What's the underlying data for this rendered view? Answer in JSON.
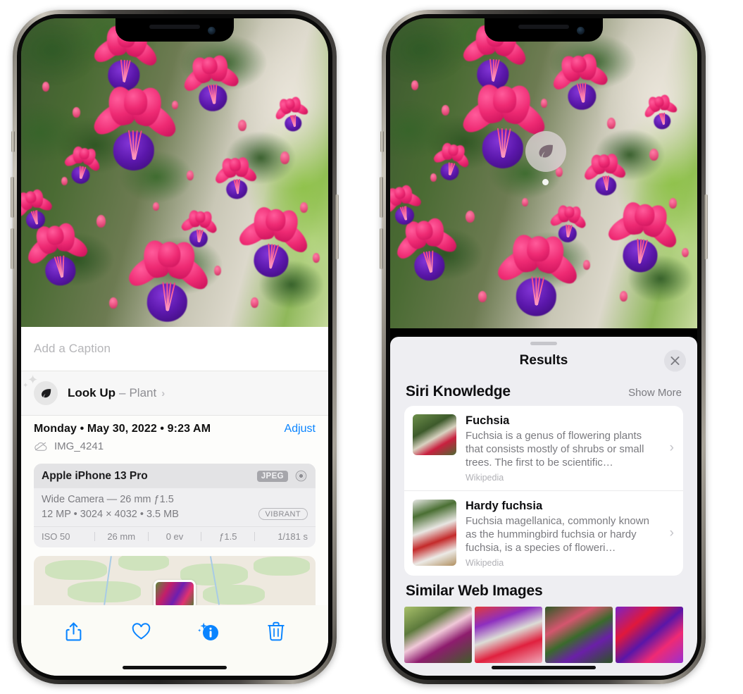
{
  "left_phone": {
    "caption": {
      "placeholder": "Add a Caption",
      "value": ""
    },
    "look_up": {
      "icon": "leaf-icon",
      "label": "Look Up",
      "separator": " – ",
      "subject": "Plant",
      "chevron": "›"
    },
    "meta": {
      "date": "Monday • May 30, 2022 • 9:23 AM",
      "adjust_label": "Adjust",
      "cloud_icon": "icloud-slash-icon",
      "filename": "IMG_4241"
    },
    "camera_card": {
      "device": "Apple iPhone 13 Pro",
      "format_badge": "JPEG",
      "hdr_icon": "aperture-icon",
      "lens_line": "Wide Camera — 26 mm ƒ1.5",
      "size_line": "12 MP • 3024 × 4032 • 3.5 MB",
      "style_badge": "VIBRANT",
      "exif": [
        "ISO 50",
        "26 mm",
        "0 ev",
        "ƒ1.5",
        "1/181 s"
      ]
    },
    "toolbar": [
      {
        "name": "share-icon",
        "label": "Share"
      },
      {
        "name": "heart-icon",
        "label": "Favorite"
      },
      {
        "name": "info-sparkle-icon",
        "label": "Info"
      },
      {
        "name": "trash-icon",
        "label": "Delete"
      }
    ]
  },
  "right_phone": {
    "visual_look_up_badge": {
      "icon": "leaf-icon"
    },
    "sheet": {
      "title": "Results",
      "close_icon": "close-icon"
    },
    "siri_knowledge": {
      "heading": "Siri Knowledge",
      "show_more": "Show More",
      "entries": [
        {
          "title": "Fuchsia",
          "description": "Fuchsia is a genus of flowering plants that consists mostly of shrubs or small trees. The first to be scientific…",
          "source": "Wikipedia",
          "chevron": "›"
        },
        {
          "title": "Hardy fuchsia",
          "description": "Fuchsia magellanica, commonly known as the hummingbird fuchsia or hardy fuchsia, is a species of floweri…",
          "source": "Wikipedia",
          "chevron": "›"
        }
      ]
    },
    "similar_web_images": {
      "heading": "Similar Web Images",
      "thumbnails": [
        "fuchsia-thumb-1",
        "fuchsia-thumb-2",
        "fuchsia-thumb-3",
        "fuchsia-thumb-4"
      ]
    }
  },
  "colors": {
    "accent_blue": "#0a84ff",
    "sheet_bg": "#fdfdfb",
    "results_bg": "#eeeef2",
    "card_bg": "#ffffff",
    "secondary_text": "#8e8e93"
  }
}
